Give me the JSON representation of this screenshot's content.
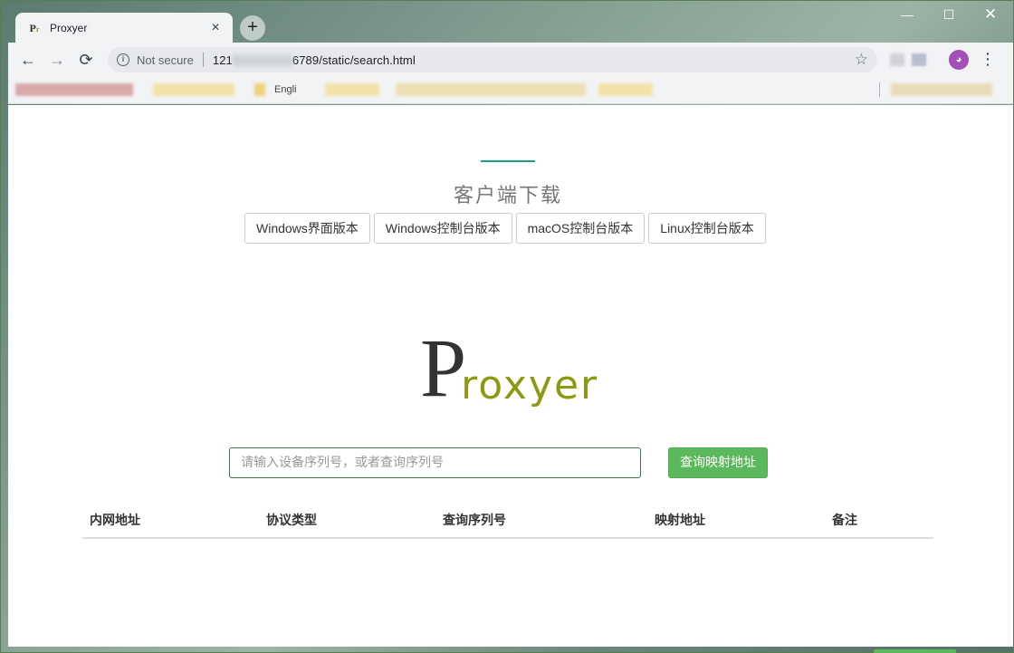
{
  "browser": {
    "tab_title": "Proxyer",
    "tab_close": "×",
    "new_tab": "+",
    "win_min": "—",
    "win_max": "☐",
    "win_close": "✕",
    "nav_back": "←",
    "nav_forward": "→",
    "nav_reload": "⟳",
    "security_label": "Not secure",
    "url_prefix": "121",
    "url_suffix": "6789/static/search.html",
    "menu": "⋮",
    "star": "☆"
  },
  "bookmarks": {
    "items": [
      "Engli"
    ]
  },
  "page": {
    "section_title": "客户端下载",
    "download_buttons": [
      "Windows界面版本",
      "Windows控制台版本",
      "macOS控制台版本",
      "Linux控制台版本"
    ],
    "logo": {
      "first_letter": "P",
      "rest": "roxyer"
    },
    "search": {
      "placeholder": "请输入设备序列号，或者查询序列号",
      "value": ""
    },
    "query_button": "查询映射地址",
    "table": {
      "headers": [
        "内网地址",
        "协议类型",
        "查询序列号",
        "映射地址",
        "备注"
      ],
      "rows": []
    }
  },
  "colors": {
    "accent_teal": "#1aa089",
    "button_green": "#5cb85c",
    "logo_olive": "#8b9a0e",
    "input_border": "#3d7a46"
  },
  "icons": {
    "back": "arrow-left-icon",
    "forward": "arrow-right-icon",
    "reload": "reload-icon",
    "info": "info-icon",
    "bookmark": "star-icon",
    "menu": "kebab-menu-icon",
    "avatar": "profile-avatar-icon"
  }
}
